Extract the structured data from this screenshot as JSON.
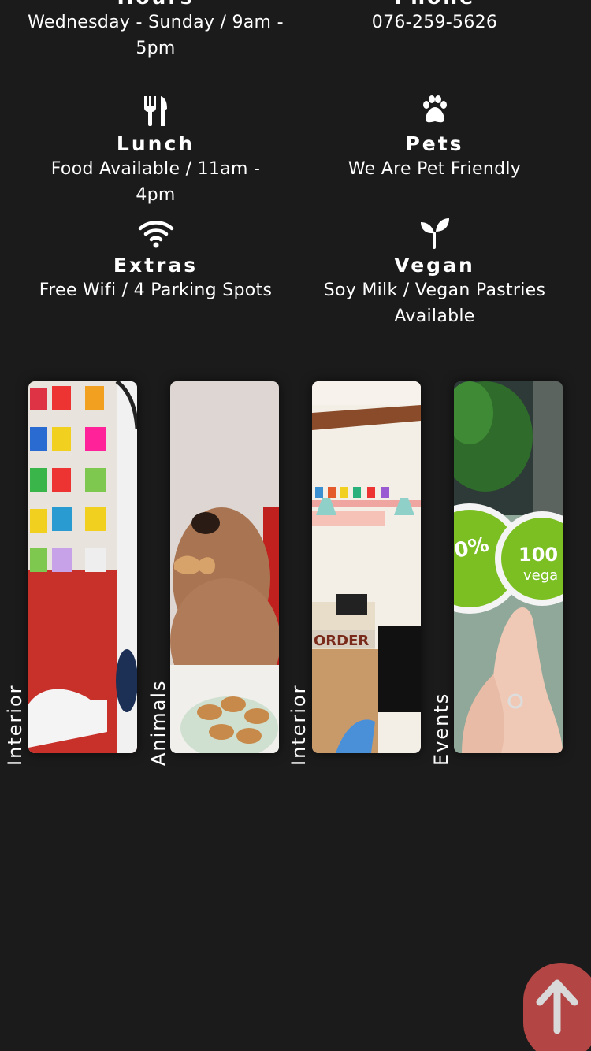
{
  "info": {
    "hours": {
      "title": "Hours",
      "text": "Wednesday - Sunday / 9am - 5pm"
    },
    "phone": {
      "title": "Phone",
      "text": "076-259-5626"
    },
    "lunch": {
      "title": "Lunch",
      "text": "Food Available / 11am - 4pm",
      "icon": "cutlery-icon"
    },
    "pets": {
      "title": "Pets",
      "text": "We Are Pet Friendly",
      "icon": "paw-icon"
    },
    "extras": {
      "title": "Extras",
      "text": "Free Wifi / 4 Parking Spots",
      "icon": "wifi-icon"
    },
    "vegan": {
      "title": "Vegan",
      "text": "Soy Milk / Vegan Pastries Available",
      "icon": "sprout-icon"
    }
  },
  "gallery": [
    {
      "label": "Interior",
      "image": "photo-wall-interior"
    },
    {
      "label": "Animals",
      "image": "dog-with-biscuit"
    },
    {
      "label": "Interior",
      "image": "cafe-order-counter"
    },
    {
      "label": "Events",
      "image": "hand-holding-vegan-stickers"
    }
  ],
  "scroll_top": {
    "icon": "arrow-up-icon",
    "color": "#b34545"
  },
  "colors": {
    "background": "#1b1b1b",
    "text": "#ffffff"
  }
}
